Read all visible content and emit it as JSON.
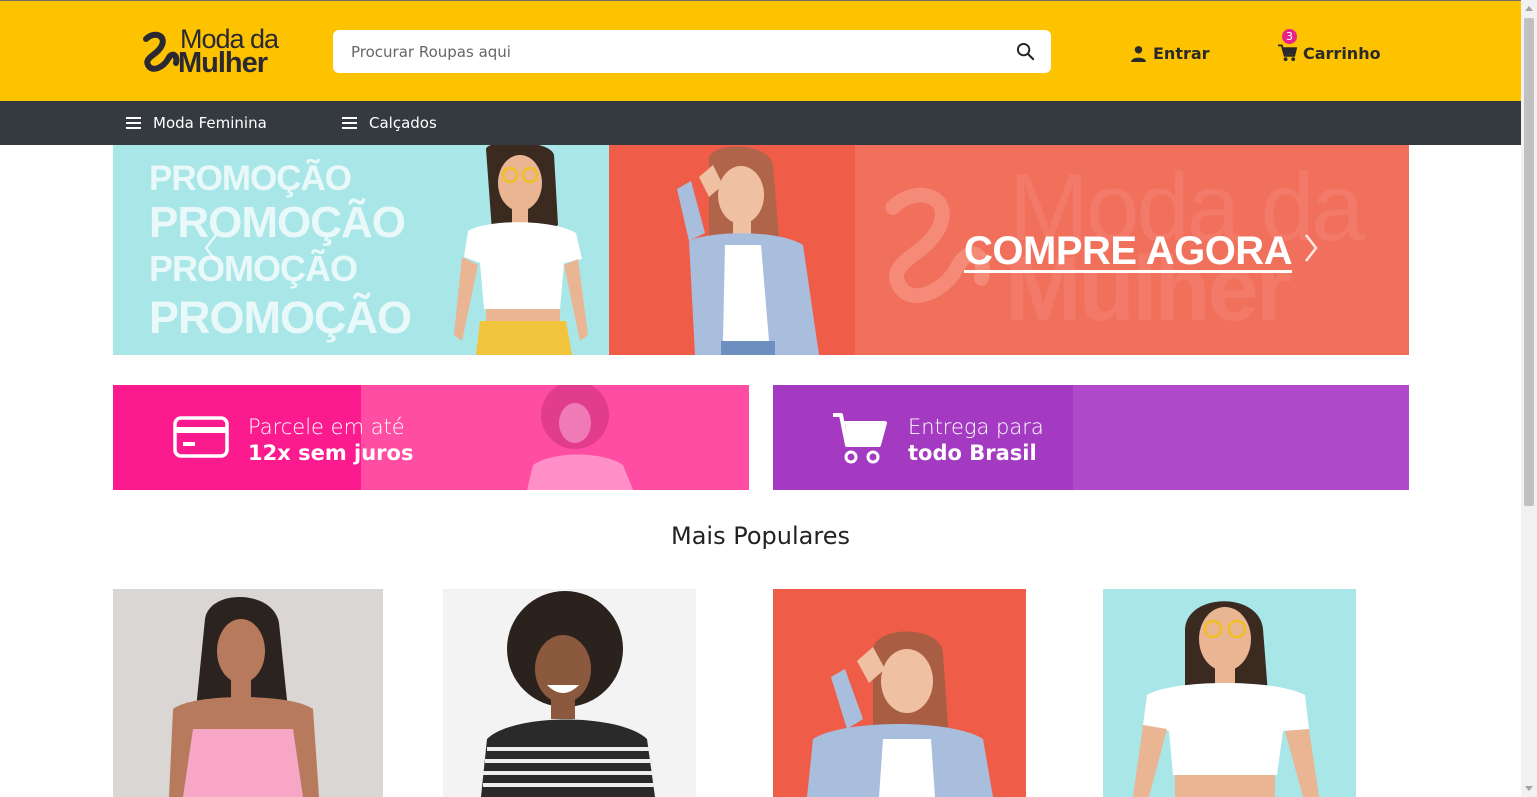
{
  "header": {
    "logo_line1": "Moda da",
    "logo_line2": "Mulher",
    "search_placeholder": "Procurar Roupas aqui",
    "login_label": "Entrar",
    "cart_label": "Carrinho",
    "cart_count": "3",
    "accent_color": "#fdc200"
  },
  "categories": [
    {
      "label": "Moda Feminina"
    },
    {
      "label": "Calçados"
    }
  ],
  "hero": {
    "promo_words": [
      "PROMOÇÃO",
      "PROMOÇÃO",
      "PROMOÇÃO",
      "PROMOÇÃO"
    ],
    "ghost_line1": "Moda da",
    "ghost_line2": "Mulher",
    "cta": "COMPRE AGORA"
  },
  "tiles": [
    {
      "line1": "Parcele em até",
      "line2": "12x sem juros",
      "icon": "credit-card-icon",
      "color": "#fc1b8e"
    },
    {
      "line1": "Entrega para",
      "line2": "todo Brasil",
      "icon": "shopping-cart-icon",
      "color": "#a43ac2"
    }
  ],
  "popular": {
    "title": "Mais Populares",
    "products": [
      {
        "icon": "product-photo-pink-top"
      },
      {
        "icon": "product-photo-striped-shirt"
      },
      {
        "icon": "product-photo-denim-shirt"
      },
      {
        "icon": "product-photo-white-crop-top"
      }
    ]
  }
}
